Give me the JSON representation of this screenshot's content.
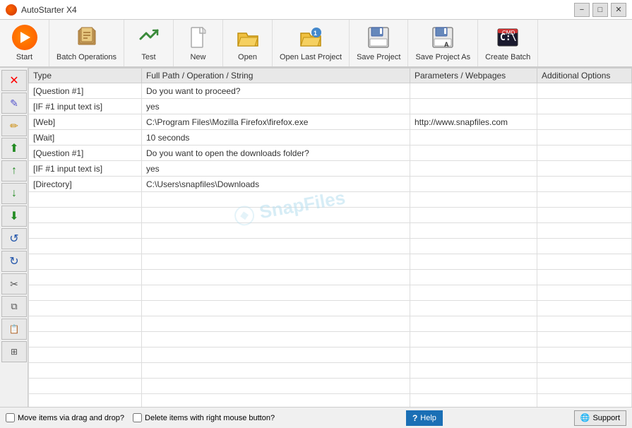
{
  "titleBar": {
    "appName": "AutoStarter X4",
    "minBtn": "−",
    "maxBtn": "□",
    "closeBtn": "✕"
  },
  "toolbar": {
    "buttons": [
      {
        "id": "start",
        "label": "Start",
        "icon": "start"
      },
      {
        "id": "batch-operations",
        "label": "Batch Operations",
        "icon": "batch"
      },
      {
        "id": "test",
        "label": "Test",
        "icon": "test"
      },
      {
        "id": "new",
        "label": "New",
        "icon": "new"
      },
      {
        "id": "open",
        "label": "Open",
        "icon": "open"
      },
      {
        "id": "open-last",
        "label": "Open Last Project",
        "icon": "open-last"
      },
      {
        "id": "save",
        "label": "Save Project",
        "icon": "save"
      },
      {
        "id": "save-as",
        "label": "Save Project As",
        "icon": "save-as"
      },
      {
        "id": "create-batch",
        "label": "Create Batch",
        "icon": "create-batch"
      }
    ]
  },
  "table": {
    "headers": [
      "Type",
      "Full Path / Operation / String",
      "Parameters / Webpages",
      "Additional Options"
    ],
    "rows": [
      {
        "type": "[Question #1]",
        "path": "Do you want to proceed?",
        "params": "",
        "options": ""
      },
      {
        "type": "[IF #1 input text is]",
        "path": "yes",
        "params": "",
        "options": ""
      },
      {
        "type": "[Web]",
        "path": "C:\\Program Files\\Mozilla Firefox\\firefox.exe",
        "params": "http://www.snapfiles.com",
        "options": ""
      },
      {
        "type": "[Wait]",
        "path": "10 seconds",
        "params": "",
        "options": ""
      },
      {
        "type": "[Question #1]",
        "path": "Do you want to open the downloads folder?",
        "params": "",
        "options": ""
      },
      {
        "type": "[IF #1 input text is]",
        "path": "yes",
        "params": "",
        "options": ""
      },
      {
        "type": "[Directory]",
        "path": "C:\\Users\\snapfiles\\Downloads",
        "params": "",
        "options": ""
      }
    ],
    "emptyRows": 15
  },
  "sidebar": {
    "buttons": [
      {
        "id": "delete",
        "icon": "✕",
        "color": "red"
      },
      {
        "id": "edit",
        "icon": "✎",
        "color": "blue"
      },
      {
        "id": "pencil",
        "icon": "✏",
        "color": "yellow"
      },
      {
        "id": "move-up-fast",
        "icon": "⬆",
        "color": "green"
      },
      {
        "id": "move-up",
        "icon": "↑",
        "color": "green"
      },
      {
        "id": "move-down",
        "icon": "↓",
        "color": "green"
      },
      {
        "id": "move-down-fast",
        "icon": "⬇",
        "color": "green"
      },
      {
        "id": "rotate-left",
        "icon": "↺",
        "color": "blue"
      },
      {
        "id": "rotate-right",
        "icon": "↻",
        "color": "blue"
      },
      {
        "id": "scissors",
        "icon": "✂",
        "color": "gray"
      },
      {
        "id": "copy",
        "icon": "⎘",
        "color": "gray"
      },
      {
        "id": "paste",
        "icon": "📋",
        "color": "gray"
      },
      {
        "id": "duplicate",
        "icon": "⧉",
        "color": "gray"
      }
    ]
  },
  "statusBar": {
    "dragDrop": "Move items via drag and drop?",
    "deleteRight": "Delete items with right mouse button?",
    "helpLabel": "Help",
    "supportLabel": "Support"
  },
  "watermark": "SnapFiles"
}
